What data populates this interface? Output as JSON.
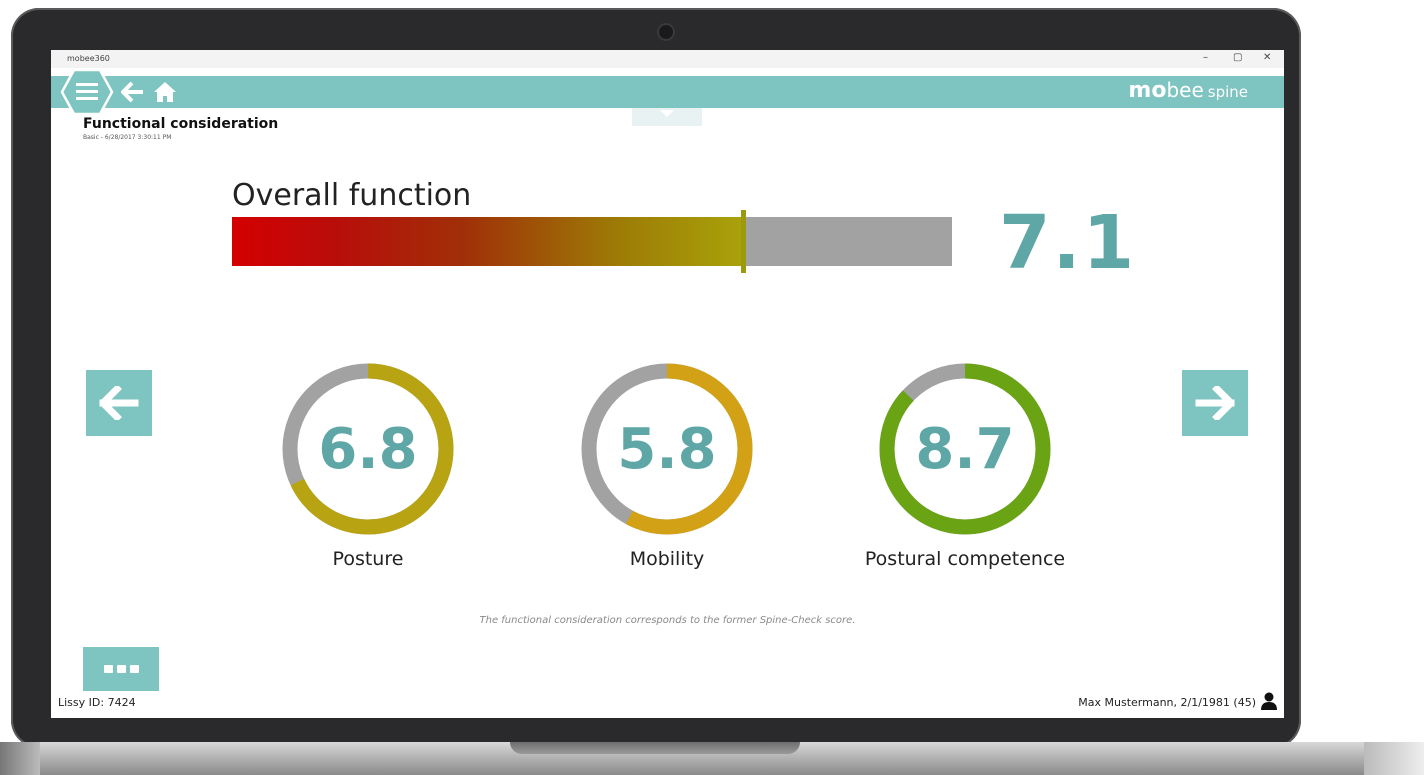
{
  "window": {
    "title": "mobee360",
    "minimize": "–",
    "maximize": "▢",
    "close": "✕"
  },
  "appbar": {
    "brand_bold": "mo",
    "brand_regular": "bee",
    "brand_small": "spine",
    "menu_icon": "menu-icon",
    "back_icon": "back-arrow-icon",
    "home_icon": "home-icon"
  },
  "page": {
    "title": "Functional consideration",
    "subtitle": "Basic - 6/28/2017 3:30:11 PM"
  },
  "overall": {
    "label": "Overall function",
    "value": "7.1",
    "fill_fraction": 0.71
  },
  "gauges": [
    {
      "label": "Posture",
      "value": "6.8",
      "fraction": 0.68,
      "color": "#b8a313"
    },
    {
      "label": "Mobility",
      "value": "5.8",
      "fraction": 0.58,
      "color": "#d2a116"
    },
    {
      "label": "Postural competence",
      "value": "8.7",
      "fraction": 0.87,
      "color": "#6aa414"
    }
  ],
  "footnote": "The functional consideration corresponds to the former Spine-Check score.",
  "footer": {
    "left": "Lissy ID: 7424",
    "right": "Max Mustermann, 2/1/1981 (45)"
  },
  "colors": {
    "accent": "#7ec4c0",
    "value_text": "#5fa6a6",
    "track": "#a2a2a2"
  }
}
